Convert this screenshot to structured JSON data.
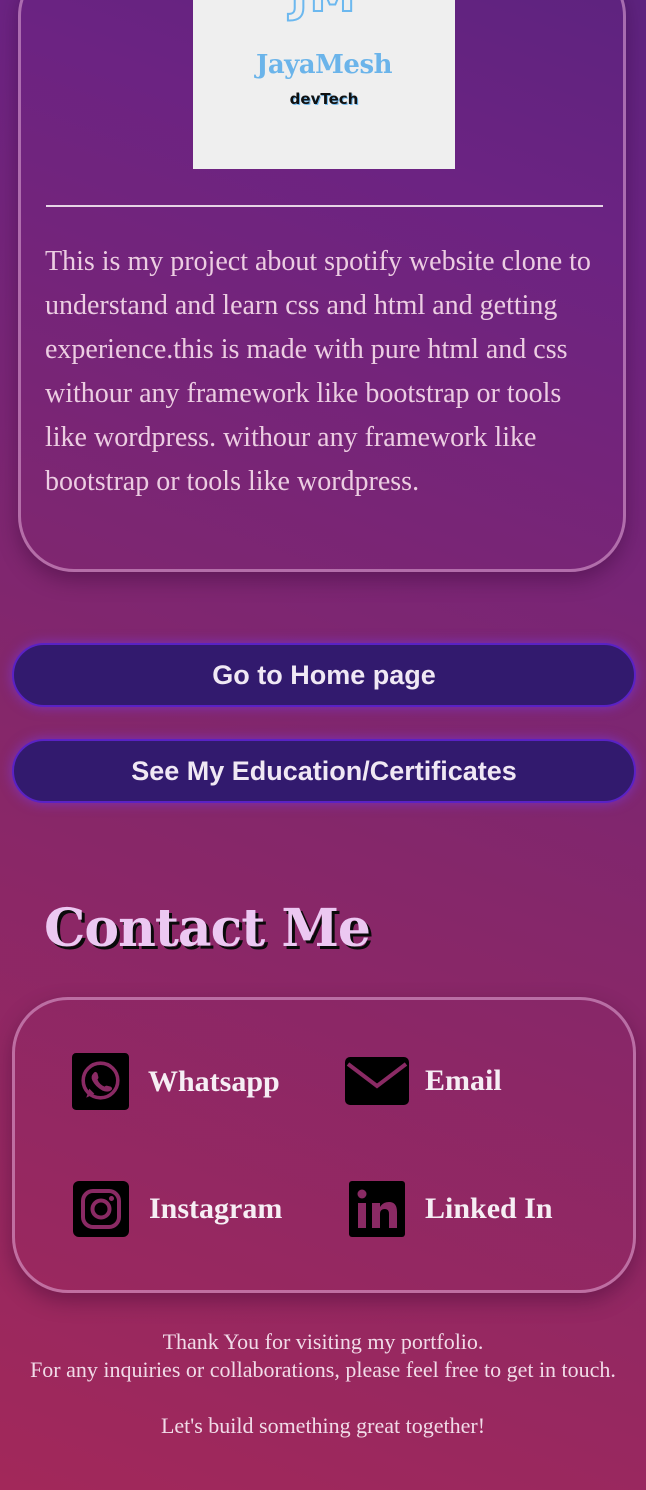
{
  "project_card": {
    "logo": {
      "mark": "JM",
      "name": "JayaMesh",
      "sub": "devTech"
    },
    "description": "This is my project about spotify website clone to understand and learn css and html and getting experience.this is made with pure html and css withour any framework like bootstrap or tools like wordpress. withour any framework like bootstrap or tools like wordpress."
  },
  "buttons": {
    "home": "Go to Home page",
    "education": "See My Education/Certificates"
  },
  "contact": {
    "title": "Contact Me",
    "items": [
      {
        "label": "Whatsapp",
        "icon": "whatsapp-icon"
      },
      {
        "label": "Email",
        "icon": "email-icon"
      },
      {
        "label": "Instagram",
        "icon": "instagram-icon"
      },
      {
        "label": "Linked In",
        "icon": "linkedin-icon"
      }
    ]
  },
  "footer": {
    "line1": "Thank You for visiting my portfolio.",
    "line2": "For any inquiries or collaborations, please feel free to get in touch.",
    "line3": "Let's build something great together!"
  },
  "colors": {
    "accent_button": "#321a6e",
    "button_border": "#5a22c4",
    "background_top": "#6c2382",
    "background_bottom": "#a2285a",
    "title_text": "#ecc8f2"
  }
}
